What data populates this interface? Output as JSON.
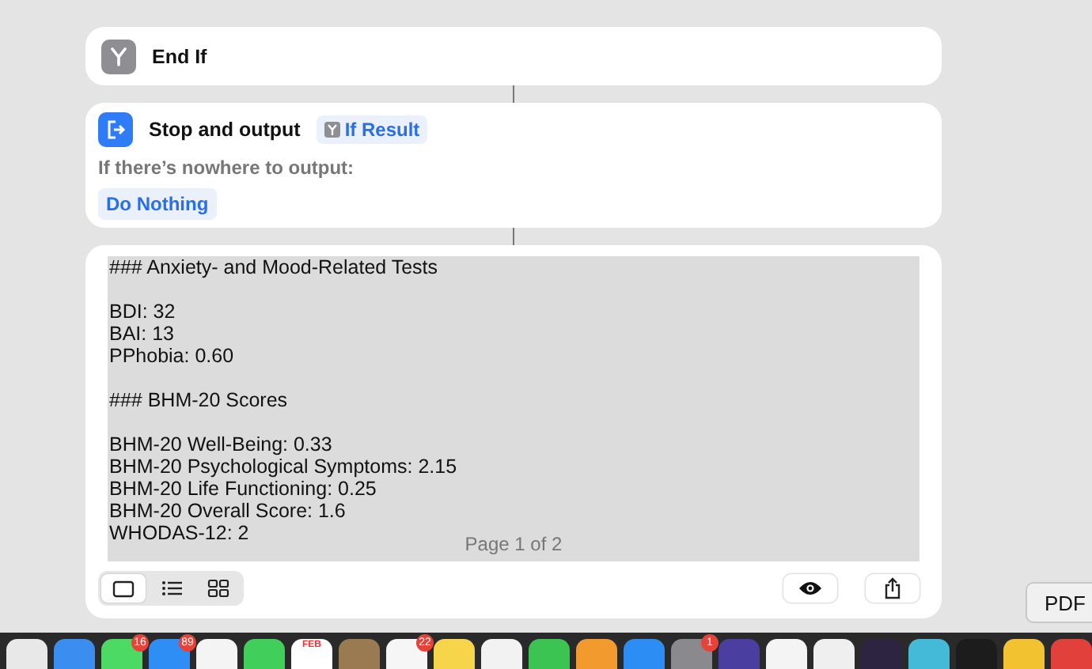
{
  "end_if": {
    "title": "End If"
  },
  "stop_output": {
    "title": "Stop and output",
    "variable": "If Result",
    "fallback_label": "If there’s nowhere to output:",
    "fallback_value": "Do Nothing"
  },
  "preview": {
    "blocks": [
      [
        "### Anxiety- and Mood-Related Tests"
      ],
      [
        "BDI: 32",
        "BAI: 13",
        "PPhobia: 0.60"
      ],
      [
        "### BHM-20 Scores"
      ],
      [
        "BHM-20 Well-Being: 0.33",
        "BHM-20 Psychological Symptoms: 2.15",
        "BHM-20 Life Functioning: 0.25",
        "BHM-20 Overall Score: 1.6",
        "WHODAS-12: 2"
      ]
    ],
    "page_indicator": "Page 1 of 2",
    "view_modes": [
      {
        "kind": "single",
        "selected": true
      },
      {
        "kind": "list",
        "selected": false
      },
      {
        "kind": "grid",
        "selected": false
      }
    ]
  },
  "tooltip": "PDF",
  "dock": {
    "items": [
      {
        "color": "#e8e8e8"
      },
      {
        "color": "#3a8ef0"
      },
      {
        "color": "#4cd964",
        "badge": "16"
      },
      {
        "color": "#2f8ef5",
        "badge": "89"
      },
      {
        "color": "#f4f4f4"
      },
      {
        "color": "#3fcf5a"
      },
      {
        "color": "#ffffff",
        "month": "FEB"
      },
      {
        "color": "#9a7a50"
      },
      {
        "color": "#f6f6f6",
        "badge": "22"
      },
      {
        "color": "#f7d54a"
      },
      {
        "color": "#f2f2f2"
      },
      {
        "color": "#3cc453"
      },
      {
        "color": "#f39a2e"
      },
      {
        "color": "#2c8df4"
      },
      {
        "color": "#8a8a8e",
        "badge": "1"
      },
      {
        "color": "#4a3fa0"
      },
      {
        "color": "#f4f4f4"
      },
      {
        "color": "#efefef"
      },
      {
        "color": "#2c2440"
      },
      {
        "color": "#45b9d8"
      },
      {
        "color": "#1c1c1c"
      },
      {
        "color": "#f2c230"
      },
      {
        "color": "#e2403a"
      }
    ]
  }
}
